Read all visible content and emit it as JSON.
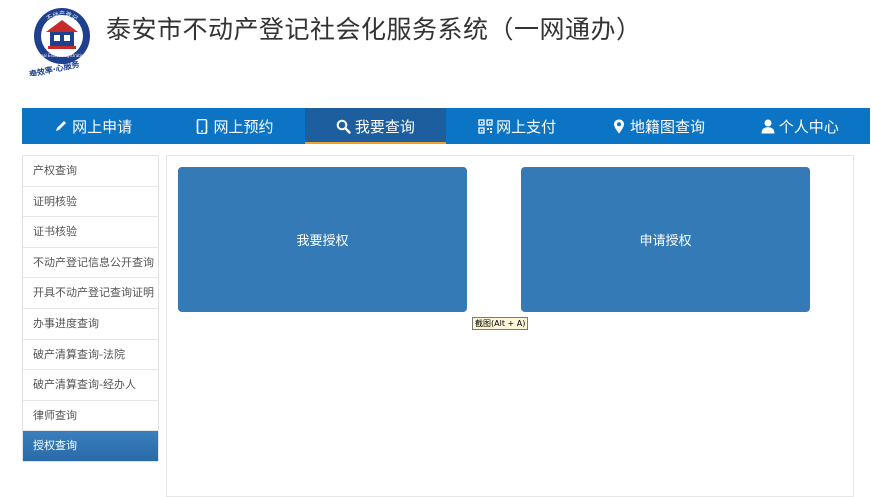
{
  "header": {
    "title": "泰安市不动产登记社会化服务系统（一网通办）",
    "logo": {
      "top_text": "不动产登记",
      "middle_text": "Real Estate Registration",
      "bottom_text": "泰效率·心服务"
    }
  },
  "nav": {
    "items": [
      {
        "label": "网上申请",
        "icon": "pencil-icon"
      },
      {
        "label": "网上预约",
        "icon": "mobile-icon"
      },
      {
        "label": "我要查询",
        "icon": "search-icon",
        "active": true
      },
      {
        "label": "网上支付",
        "icon": "qrcode-icon"
      },
      {
        "label": "地籍图查询",
        "icon": "map-marker-icon"
      },
      {
        "label": "个人中心",
        "icon": "user-icon"
      }
    ]
  },
  "sidebar": {
    "items": [
      {
        "label": "产权查询"
      },
      {
        "label": "证明核验"
      },
      {
        "label": "证书核验"
      },
      {
        "label": "不动产登记信息公开查询"
      },
      {
        "label": "开具不动产登记查询证明"
      },
      {
        "label": "办事进度查询"
      },
      {
        "label": "破产清算查询-法院"
      },
      {
        "label": "破产清算查询-经办人"
      },
      {
        "label": "律师查询"
      },
      {
        "label": "授权查询",
        "active": true
      }
    ]
  },
  "main": {
    "cards": [
      {
        "label": "我要授权"
      },
      {
        "label": "申请授权"
      }
    ]
  },
  "tooltip": {
    "text": "截图(Alt + A)"
  },
  "colors": {
    "nav_bg": "#0c74c4",
    "nav_active_bg": "#1d5f9e",
    "nav_active_underline": "#f0a029",
    "card_bg": "#337ab7",
    "sidebar_active_bg": "#2f73b3"
  }
}
